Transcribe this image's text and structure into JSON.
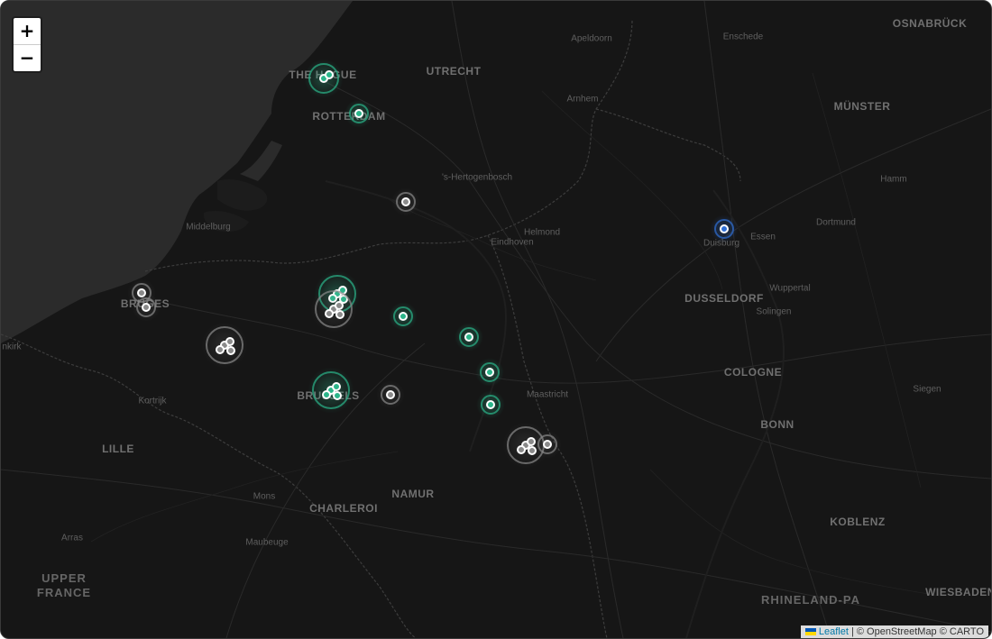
{
  "map": {
    "controls": {
      "zoom_in": "+",
      "zoom_out": "−"
    },
    "attribution": {
      "leaflet": "Leaflet",
      "rest": " | © OpenStreetMap © CARTO"
    },
    "colors": {
      "background": "#161616",
      "sea": "#2b2b2b",
      "land": "#161616",
      "green_marker": "#2bb58a",
      "gray_marker": "#8a8a8a",
      "blue_marker": "#2f6fd6"
    },
    "places": [
      {
        "name": "OSNABRÜCK",
        "kind": "city"
      },
      {
        "name": "Apeldoorn",
        "kind": "town"
      },
      {
        "name": "Enschede",
        "kind": "town"
      },
      {
        "name": "UTRECHT",
        "kind": "city"
      },
      {
        "name": "THE HAGUE",
        "kind": "city"
      },
      {
        "name": "ROTTERDAM",
        "kind": "city"
      },
      {
        "name": "Arnhem",
        "kind": "town"
      },
      {
        "name": "MÜNSTER",
        "kind": "city"
      },
      {
        "name": "'s-Hertogenbosch",
        "kind": "town"
      },
      {
        "name": "Hamm",
        "kind": "town"
      },
      {
        "name": "Middelburg",
        "kind": "town"
      },
      {
        "name": "Helmond",
        "kind": "town"
      },
      {
        "name": "Eindhoven",
        "kind": "town"
      },
      {
        "name": "Dortmund",
        "kind": "town"
      },
      {
        "name": "Duisburg",
        "kind": "town"
      },
      {
        "name": "Essen",
        "kind": "town"
      },
      {
        "name": "BRUGES",
        "kind": "city"
      },
      {
        "name": "DUSSELDORF",
        "kind": "city"
      },
      {
        "name": "Wuppertal",
        "kind": "town"
      },
      {
        "name": "Solingen",
        "kind": "town"
      },
      {
        "name": "nkirk",
        "kind": "town"
      },
      {
        "name": "COLOGNE",
        "kind": "city"
      },
      {
        "name": "Kortrijk",
        "kind": "town"
      },
      {
        "name": "Maastricht",
        "kind": "town"
      },
      {
        "name": "BRUSSELS",
        "kind": "city"
      },
      {
        "name": "Siegen",
        "kind": "town"
      },
      {
        "name": "BONN",
        "kind": "city"
      },
      {
        "name": "LILLE",
        "kind": "city"
      },
      {
        "name": "NAMUR",
        "kind": "city"
      },
      {
        "name": "Mons",
        "kind": "town"
      },
      {
        "name": "CHARLEROI",
        "kind": "city"
      },
      {
        "name": "KOBLENZ",
        "kind": "city"
      },
      {
        "name": "Arras",
        "kind": "town"
      },
      {
        "name": "Maubeuge",
        "kind": "town"
      },
      {
        "name": "UPPER FRANCE",
        "kind": "region"
      },
      {
        "name": "RHINELAND-PA",
        "kind": "region"
      },
      {
        "name": "WIESBADEN",
        "kind": "city"
      }
    ],
    "markers": [
      {
        "type": "green",
        "size": "large"
      },
      {
        "type": "green",
        "size": "medium"
      },
      {
        "type": "gray",
        "size": "medium"
      },
      {
        "type": "blue",
        "size": "medium"
      },
      {
        "type": "gray",
        "size": "medium"
      },
      {
        "type": "gray",
        "size": "medium"
      },
      {
        "type": "green",
        "size": "cluster"
      },
      {
        "type": "gray",
        "size": "cluster"
      },
      {
        "type": "green",
        "size": "medium"
      },
      {
        "type": "green",
        "size": "medium"
      },
      {
        "type": "gray",
        "size": "cluster"
      },
      {
        "type": "green",
        "size": "medium"
      },
      {
        "type": "green",
        "size": "medium"
      },
      {
        "type": "green",
        "size": "cluster"
      },
      {
        "type": "gray",
        "size": "medium"
      },
      {
        "type": "gray",
        "size": "cluster"
      },
      {
        "type": "gray",
        "size": "medium"
      }
    ]
  }
}
